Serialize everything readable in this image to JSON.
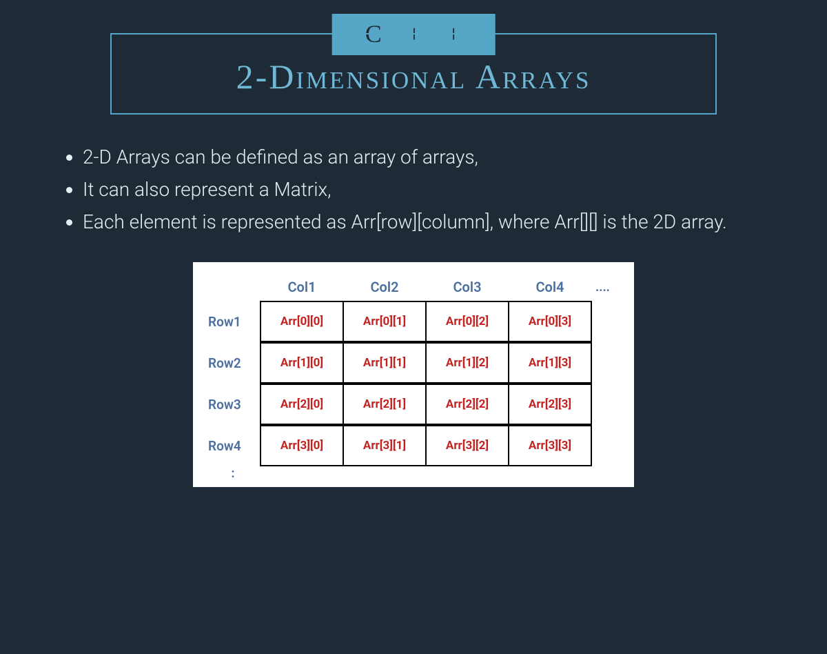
{
  "header": {
    "badge": "C + +",
    "title": "2-Dimensional Arrays"
  },
  "bullets": [
    "2-D Arrays can be defined as an array of arrays,",
    "It can also represent a Matrix,",
    "Each element is represented as Arr[row][column], where Arr[][] is the 2D array."
  ],
  "diagram": {
    "col_headers": [
      "Col1",
      "Col2",
      "Col3",
      "Col4"
    ],
    "col_ellipsis": "....",
    "row_headers": [
      "Row1",
      "Row2",
      "Row3",
      "Row4"
    ],
    "row_ellipsis": ":",
    "cells": [
      [
        "Arr[0][0]",
        "Arr[0][1]",
        "Arr[0][2]",
        "Arr[0][3]"
      ],
      [
        "Arr[1][0]",
        "Arr[1][1]",
        "Arr[1][2]",
        "Arr[1][3]"
      ],
      [
        "Arr[2][0]",
        "Arr[2][1]",
        "Arr[2][2]",
        "Arr[2][3]"
      ],
      [
        "Arr[3][0]",
        "Arr[3][1]",
        "Arr[3][2]",
        "Arr[3][3]"
      ]
    ]
  }
}
